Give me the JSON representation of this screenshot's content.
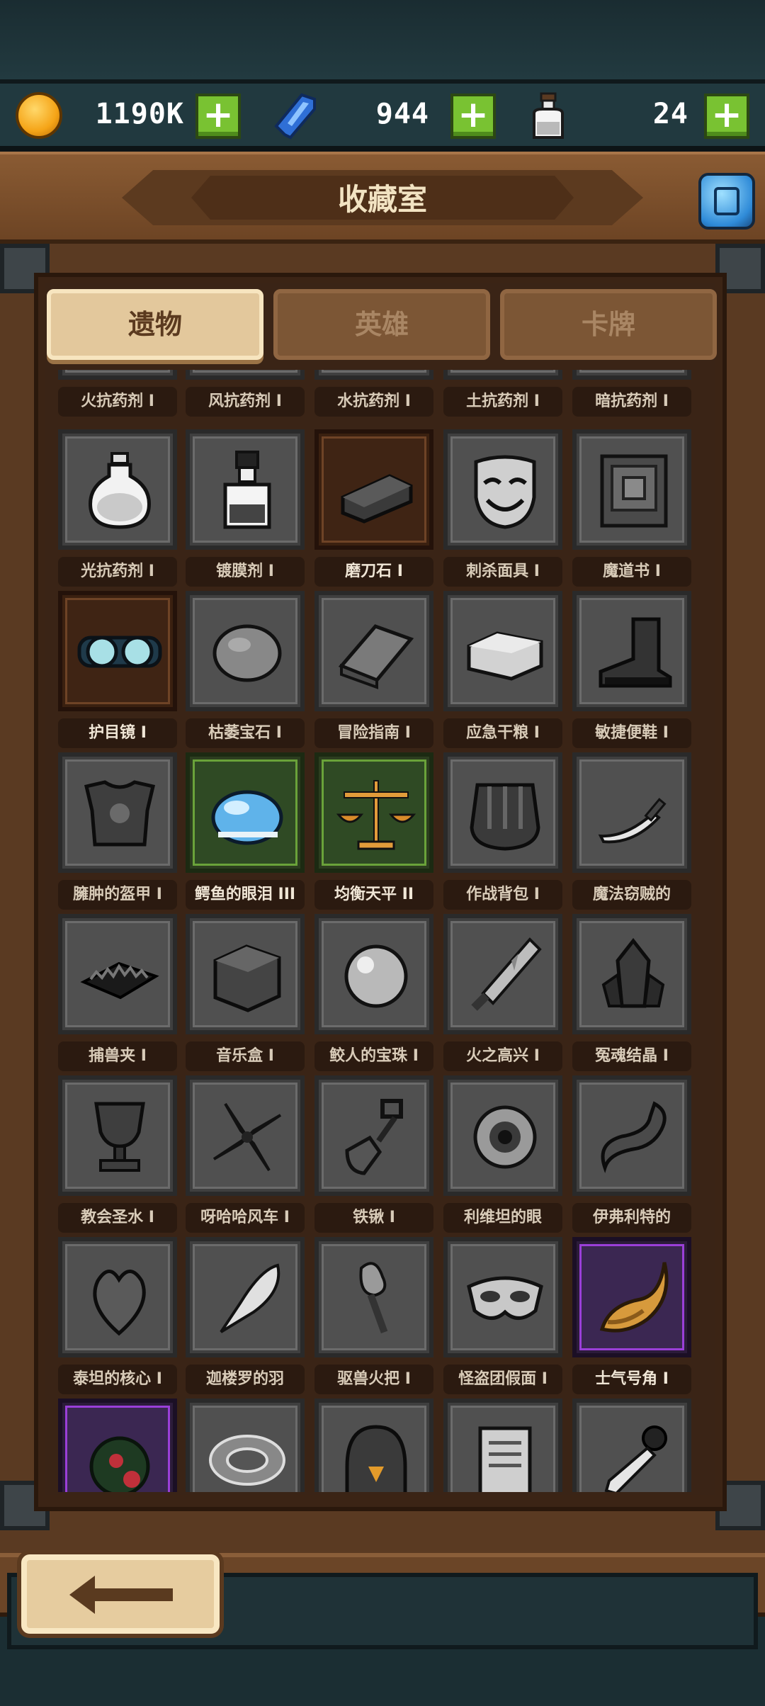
{
  "resources": {
    "gold": "1190K",
    "gems": "944",
    "potions": "24"
  },
  "header": {
    "title": "收藏室"
  },
  "tabs": [
    {
      "label": "遗物",
      "active": true
    },
    {
      "label": "英雄",
      "active": false
    },
    {
      "label": "卡牌",
      "active": false
    }
  ],
  "top_row_labels": [
    "火抗药剂 I",
    "风抗药剂 I",
    "水抗药剂 I",
    "土抗药剂 I",
    "暗抗药剂 I"
  ],
  "items": [
    {
      "label": "光抗药剂 I",
      "icon": "potion-flask-icon",
      "frame": "gray"
    },
    {
      "label": "镀膜剂 I",
      "icon": "coating-bottle-icon",
      "frame": "gray"
    },
    {
      "label": "磨刀石 I",
      "icon": "whetstone-icon",
      "frame": "brown"
    },
    {
      "label": "刺杀面具 I",
      "icon": "assassin-mask-icon",
      "frame": "gray"
    },
    {
      "label": "魔道书 I",
      "icon": "spellbook-icon",
      "frame": "gray"
    },
    {
      "label": "护目镜 I",
      "icon": "goggles-icon",
      "frame": "brown"
    },
    {
      "label": "枯萎宝石 I",
      "icon": "withered-gem-icon",
      "frame": "gray"
    },
    {
      "label": "冒险指南 I",
      "icon": "guide-book-icon",
      "frame": "gray"
    },
    {
      "label": "应急干粮 I",
      "icon": "ration-icon",
      "frame": "gray"
    },
    {
      "label": "敏捷便鞋 I",
      "icon": "boot-icon",
      "frame": "gray"
    },
    {
      "label": "臃肿的盔甲 I",
      "icon": "armor-icon",
      "frame": "gray"
    },
    {
      "label": "鳄鱼的眼泪 III",
      "icon": "blue-tear-icon",
      "frame": "green"
    },
    {
      "label": "均衡天平 II",
      "icon": "balance-scale-icon",
      "frame": "green"
    },
    {
      "label": "作战背包 I",
      "icon": "backpack-icon",
      "frame": "gray"
    },
    {
      "label": "魔法窃贼的",
      "icon": "curved-dagger-icon",
      "frame": "gray"
    },
    {
      "label": "捕兽夹 I",
      "icon": "bear-trap-icon",
      "frame": "gray"
    },
    {
      "label": "音乐盒 I",
      "icon": "music-box-icon",
      "frame": "gray"
    },
    {
      "label": "鲛人的宝珠 I",
      "icon": "pearl-icon",
      "frame": "gray"
    },
    {
      "label": "火之高兴 I",
      "icon": "fire-sword-icon",
      "frame": "gray"
    },
    {
      "label": "冤魂结晶 I",
      "icon": "soul-crystal-icon",
      "frame": "gray"
    },
    {
      "label": "教会圣水 I",
      "icon": "chalice-icon",
      "frame": "gray"
    },
    {
      "label": "呀哈哈风车 I",
      "icon": "pinwheel-icon",
      "frame": "gray"
    },
    {
      "label": "铁锹 I",
      "icon": "shovel-icon",
      "frame": "gray"
    },
    {
      "label": "利维坦的眼",
      "icon": "eye-icon",
      "frame": "gray"
    },
    {
      "label": "伊弗利特的",
      "icon": "ifrit-horn-icon",
      "frame": "gray"
    },
    {
      "label": "泰坦的核心 I",
      "icon": "titan-heart-icon",
      "frame": "gray"
    },
    {
      "label": "迦楼罗的羽",
      "icon": "feather-icon",
      "frame": "gray"
    },
    {
      "label": "驱兽火把 I",
      "icon": "torch-icon",
      "frame": "gray"
    },
    {
      "label": "怪盗团假面 I",
      "icon": "phantom-mask-icon",
      "frame": "gray"
    },
    {
      "label": "士气号角 I",
      "icon": "war-horn-icon",
      "frame": "purple"
    },
    {
      "label": "",
      "icon": "rose-bush-icon",
      "frame": "purple"
    },
    {
      "label": "",
      "icon": "lace-charm-icon",
      "frame": "gray"
    },
    {
      "label": "",
      "icon": "helmet-icon",
      "frame": "gray"
    },
    {
      "label": "",
      "icon": "scroll-icon",
      "frame": "gray"
    },
    {
      "label": "",
      "icon": "dagger-icon",
      "frame": "gray"
    }
  ]
}
